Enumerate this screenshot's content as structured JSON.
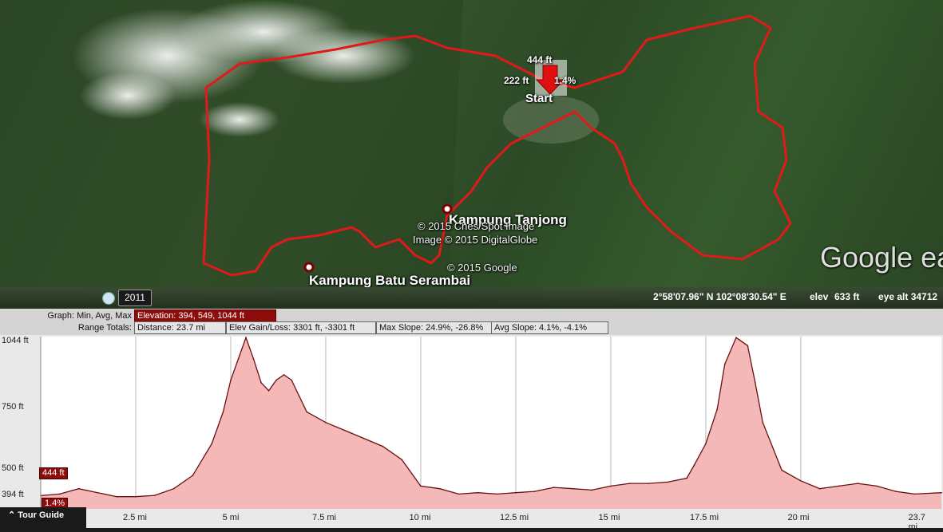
{
  "map": {
    "places": [
      "Kampung Tanjong",
      "Kampung Batu Serambai"
    ],
    "start_label": "Start",
    "marker": {
      "elevation": "444 ft",
      "left": "222 ft",
      "right": "1.4%"
    },
    "copyrights": [
      "© 2015 Cnes/Spot Image",
      "Image © 2015 DigitalGlobe",
      "© 2015 Google"
    ],
    "brand": "Google ea",
    "route_color": "#e01a1a"
  },
  "status": {
    "year": "2011",
    "coords": "2°58'07.96\" N   102°08'30.54\" E",
    "elev_label": "elev",
    "elev_value": "633 ft",
    "eye_alt": "eye alt  34712"
  },
  "graph_header": {
    "graph_label": "Graph: Min, Avg, Max",
    "elevation": "Elevation: 394, 549, 1044 ft",
    "range_label": "Range Totals:",
    "distance": "Distance: 23.7 mi",
    "gain_loss": "Elev Gain/Loss: 3301 ft, -3301 ft",
    "max_slope": "Max Slope: 24.9%, -26.8%",
    "avg_slope": "Avg Slope: 4.1%, -4.1%"
  },
  "graph": {
    "y_labels": [
      "1044 ft",
      "750 ft",
      "500 ft",
      "394 ft"
    ],
    "x_labels": [
      "2.5 mi",
      "5 mi",
      "7.5 mi",
      "10 mi",
      "12.5 mi",
      "15 mi",
      "17.5 mi",
      "20 mi",
      "23.7 mi"
    ],
    "current_value": "444 ft",
    "current_slope": "1.4%",
    "fill_color": "#f5b8b8",
    "line_color": "#6b0f0f"
  },
  "chart_data": {
    "type": "area",
    "xlabel": "",
    "ylabel": "",
    "ylim": [
      394,
      1044
    ],
    "xlim": [
      0,
      23.7
    ],
    "x": [
      0,
      0.5,
      1,
      1.5,
      2,
      2.5,
      3,
      3.5,
      4,
      4.5,
      4.8,
      5,
      5.2,
      5.4,
      5.6,
      5.8,
      6,
      6.2,
      6.4,
      6.6,
      6.8,
      7,
      7.5,
      8,
      8.5,
      9,
      9.5,
      10,
      10.5,
      11,
      11.5,
      12,
      12.5,
      13,
      13.5,
      14,
      14.5,
      15,
      15.5,
      16,
      16.5,
      17,
      17.2,
      17.5,
      17.8,
      18,
      18.3,
      18.6,
      18.8,
      19,
      19.5,
      20,
      20.5,
      21,
      21.5,
      22,
      22.5,
      23,
      23.7
    ],
    "values": [
      444,
      450,
      470,
      455,
      440,
      440,
      445,
      470,
      520,
      640,
      760,
      880,
      960,
      1040,
      960,
      870,
      840,
      880,
      900,
      880,
      820,
      760,
      720,
      690,
      660,
      630,
      580,
      480,
      470,
      450,
      455,
      450,
      455,
      460,
      475,
      470,
      465,
      480,
      490,
      490,
      495,
      510,
      560,
      640,
      770,
      940,
      1040,
      1010,
      870,
      720,
      540,
      500,
      470,
      480,
      490,
      480,
      460,
      450,
      455
    ]
  }
}
